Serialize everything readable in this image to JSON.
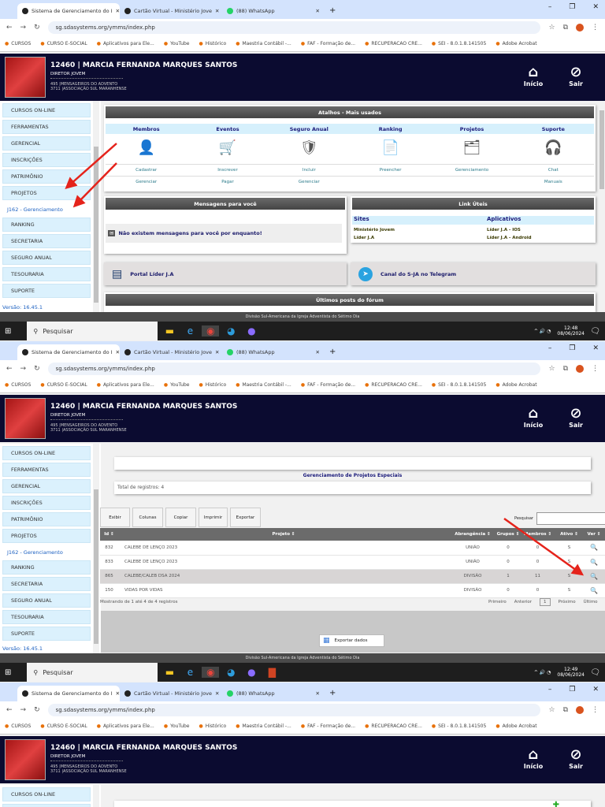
{
  "browser": {
    "tabs": [
      {
        "label": "Sistema de Gerenciamento do I"
      },
      {
        "label": "Cartão Virtual - Ministério Jove"
      },
      {
        "label": "(88) WhatsApp"
      }
    ],
    "url": "sg.sdasystems.org/ymms/index.php",
    "bookmarks": [
      {
        "label": "CURSOS"
      },
      {
        "label": "CURSO E-SOCIAL"
      },
      {
        "label": "Aplicativos para Ele..."
      },
      {
        "label": "YouTube"
      },
      {
        "label": "Histórico"
      },
      {
        "label": "Maestria Contábil -..."
      },
      {
        "label": "FAF - Formação de..."
      },
      {
        "label": "RECUPERACAO CRE..."
      },
      {
        "label": "SEI - 8.0.1.8.141505"
      },
      {
        "label": "Adobe Acrobat"
      }
    ]
  },
  "header": {
    "user": "12460 | MARCIA FERNANDA MARQUES SANTOS",
    "role": "DIRETOR JOVEM",
    "club": "495 |MENSAGEIROS DO ADVENTO",
    "association": "3711 |ASSOCIAÇÃO SUL MARANHENSE",
    "home_label": "Início",
    "logout_label": "Sair"
  },
  "sidebar": {
    "items": [
      {
        "label": "CURSOS ON-LINE",
        "icon": "🎓"
      },
      {
        "label": "FERRAMENTAS",
        "icon": "⚙"
      },
      {
        "label": "GERENCIAL",
        "icon": "◉"
      },
      {
        "label": "INSCRIÇÕES",
        "icon": "🛒"
      },
      {
        "label": "PATRIMÔNIO",
        "icon": "▣"
      },
      {
        "label": "PROJETOS",
        "icon": "⚠"
      },
      {
        "label": "J162 - Gerenciamento",
        "icon": ""
      },
      {
        "label": "RANKING",
        "icon": "🏆"
      },
      {
        "label": "SECRETARIA",
        "icon": "▮"
      },
      {
        "label": "SEGURO ANUAL",
        "icon": "▰"
      },
      {
        "label": "TESOURARIA",
        "icon": "◐"
      },
      {
        "label": "SUPORTE",
        "icon": "✥"
      }
    ],
    "version": "Versão: 16.45.1"
  },
  "home": {
    "shortcuts_title": "Atalhos - Mais usados",
    "columns": [
      {
        "title": "Membros",
        "icon": "👤",
        "link1": "Cadastrar",
        "link2": "Gerenciar"
      },
      {
        "title": "Eventos",
        "icon": "🛒",
        "link1": "Inscrever",
        "link2": "Pagar"
      },
      {
        "title": "Seguro Anual",
        "icon": "🛡",
        "link1": "Incluir",
        "link2": "Gerenciar"
      },
      {
        "title": "Ranking",
        "icon": "📄",
        "link1": "Preencher",
        "link2": ""
      },
      {
        "title": "Projetos",
        "icon": "🗂",
        "link1": "Gerenciamento",
        "link2": ""
      },
      {
        "title": "Suporte",
        "icon": "🎧",
        "link1": "Chat",
        "link2": "Manuais"
      }
    ],
    "messages_title": "Mensagens para você",
    "messages_empty": "Não existem mensagens para você por enquanto!",
    "links_title": "Link Úteis",
    "sites_header": "Sites",
    "apps_header": "Aplicativos",
    "sites": [
      "Ministério Jovem",
      "Líder J.A"
    ],
    "apps": [
      "Líder J.A - IOS",
      "Líder J.A - Android"
    ],
    "portal_label": "Portal Líder J.A",
    "telegram_label": "Canal do S-JA no Telegram",
    "forum_title": "Últimos posts do fórum"
  },
  "projects": {
    "title": "Gerenciamento de Projetos Especiais",
    "total": "Total de registros: 4",
    "buttons": [
      "Exibir",
      "Colunas",
      "Copiar",
      "Imprimir",
      "Exportar"
    ],
    "search_label": "Pesquisar",
    "search_value": "",
    "columns": [
      "Id",
      "Projeto",
      "Abrangência",
      "Grupos",
      "Membros",
      "Ativo",
      "Ver"
    ],
    "rows": [
      {
        "id": "832",
        "name": "CALEBE DE LENÇO 2023",
        "scope": "UNIÃO",
        "groups": "0",
        "members": "0",
        "active": "S"
      },
      {
        "id": "833",
        "name": "CALEBE DE LENÇO 2023",
        "scope": "UNIÃO",
        "groups": "0",
        "members": "0",
        "active": "S"
      },
      {
        "id": "865",
        "name": "CALEBE/CALEB DSA 2024",
        "scope": "DIVISÃO",
        "groups": "1",
        "members": "11",
        "active": "S"
      },
      {
        "id": "150",
        "name": "VIDAS POR VIDAS",
        "scope": "DIVISÃO",
        "groups": "0",
        "members": "0",
        "active": "S"
      }
    ],
    "info": "Mostrando de 1 até 4 de 4 registros",
    "pager": {
      "first": "Primeiro",
      "prev": "Anterior",
      "page": "1",
      "next": "Próximo",
      "last": "Último"
    },
    "export_label": "Exportar dados"
  },
  "footer": "Divisão Sul-Americana da Igreja Adventista do Sétimo Dia",
  "taskbar": {
    "search": "Pesquisar",
    "screens": [
      {
        "time": "12:48",
        "date": "08/06/2024"
      },
      {
        "time": "12:49",
        "date": "08/06/2024"
      }
    ]
  },
  "colors": {
    "header": "#0b0b30",
    "sidebar_item": "#dbf1fd",
    "arrow": "#e5231b",
    "panel_bar": "#555555"
  }
}
